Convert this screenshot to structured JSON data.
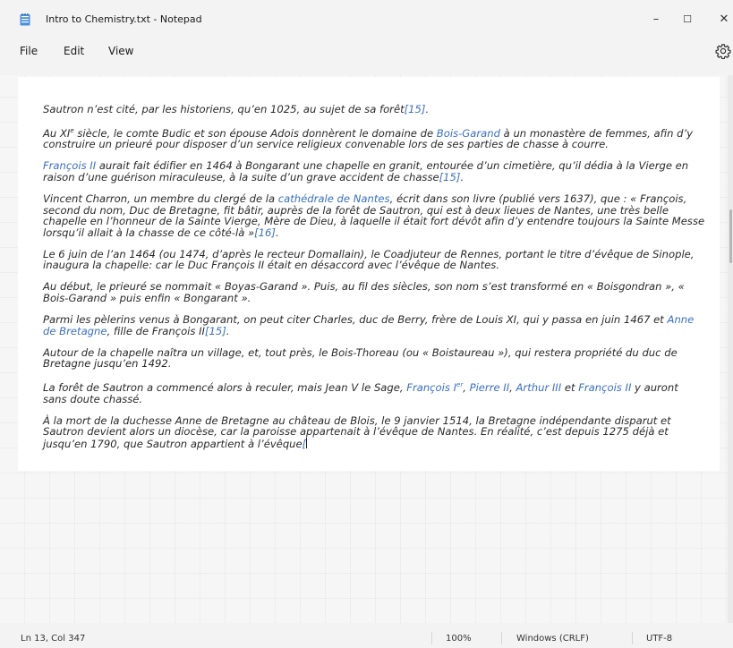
{
  "window": {
    "title": "Intro to Chemistry.txt - Notepad",
    "minimize": "–",
    "maximize": "☐",
    "close": "✕"
  },
  "menu": {
    "file": "File",
    "edit": "Edit",
    "view": "View"
  },
  "icons": {
    "app": "notepad-icon",
    "settings": "gear-icon"
  },
  "document": {
    "p1": {
      "t1": "Sautron n’est cité, par les historiens, qu’en 1025, au sujet de sa forêt",
      "ref": "[15]",
      "t2": "."
    },
    "p2": {
      "t1": "Au XI",
      "sup": "e",
      "t2": " siècle, le comte Budic et son épouse Adois donnèrent le domaine de ",
      "link": "Bois-Garand",
      "t3": " à un monastère de femmes, afin d’y construire un prieuré pour disposer d’un service religieux convenable lors de ses parties de chasse à courre."
    },
    "p3": {
      "link": "François II",
      "t1": " aurait fait édifier en 1464 à Bongarant une chapelle en granit, entourée d’un cimetière, qu’il dédia à la Vierge en raison d’une guérison miraculeuse, à la suite d’un grave accident de chasse",
      "ref": "[15]",
      "t2": "."
    },
    "p4": {
      "t1": "Vincent Charron, un membre du clergé de la ",
      "link": "cathédrale de Nantes",
      "t2": ", écrit dans son livre (publié vers 1637), que : « François, second du nom, Duc de Bretagne, fit bâtir, auprès de la forêt de Sautron, qui est à deux lieues de Nantes, une très belle chapelle en l’honneur de la Sainte Vierge, Mère de Dieu, à laquelle il était fort dévôt afin d’y entendre toujours la Sainte Messe lorsqu’il allait à la chasse de ce côté-là »",
      "ref": "[16]",
      "t3": "."
    },
    "p5": {
      "t1": "Le 6 juin de l’an 1464 (ou 1474, d’après le recteur Domallain), le Coadjuteur de Rennes, portant le titre d’évêque de Sinople, inaugura la chapelle: car le Duc François II était en désaccord avec l’évêque de Nantes."
    },
    "p6": {
      "t1": "Au début, le prieuré se nommait « Boyas-Garand ». Puis, au fil des siècles, son nom s’est transformé en « Boisgondran », « Bois-Garand » puis enfin « Bongarant »."
    },
    "p7": {
      "t1": "Parmi les pèlerins venus à Bongarant, on peut citer Charles, duc de Berry, frère de Louis XI, qui y passa en juin 1467 et ",
      "link": "Anne de Bretagne",
      "t2": ", fille de François II",
      "ref": "[15]",
      "t3": "."
    },
    "p8": {
      "t1": "Autour de la chapelle naîtra un village, et, tout près, le Bois-Thoreau (ou « Boistaureau »), qui restera propriété du duc de Bretagne jusqu’en 1492."
    },
    "p9": {
      "t1": "La forêt de Sautron a commencé alors à reculer, mais Jean V le Sage, ",
      "link1": "François I",
      "sup": "er",
      "t2": ", ",
      "link2": "Pierre II",
      "t3": ", ",
      "link3": "Arthur III",
      "t4": " et ",
      "link4": "François II",
      "t5": " y auront sans doute chassé."
    },
    "p10": {
      "t1": "À la mort de la duchesse Anne de Bretagne au château de Blois, le 9 janvier 1514, la Bretagne indépendante disparut et Sautron devient alors un diocèse, car la paroisse appartenait à l’évêque de Nantes. En réalité, c’est depuis 1275 déjà et jusqu’en 1790, que Sautron appartient à l’évêque",
      "ref": "["
    }
  },
  "status": {
    "position": "Ln 13, Col 347",
    "zoom": "100%",
    "line_ending": "Windows (CRLF)",
    "encoding": "UTF-8"
  }
}
